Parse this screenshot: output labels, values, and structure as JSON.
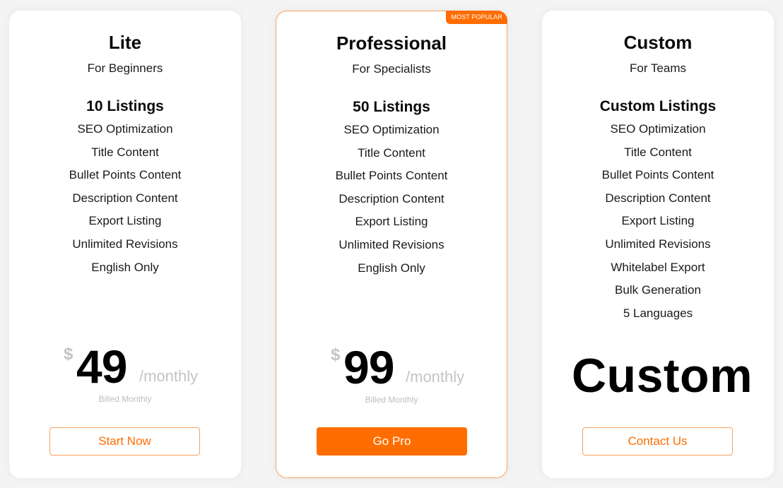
{
  "colors": {
    "accent": "#ff6d00",
    "accent_border": "#f7a25e",
    "muted_text": "#c4c4c4",
    "background": "#f4f4f4",
    "card": "#ffffff"
  },
  "plans": [
    {
      "name": "Lite",
      "audience": "For Beginners",
      "listings": "10 Listings",
      "features": [
        "SEO Optimization",
        "Title Content",
        "Bullet Points Content",
        "Description Content",
        "Export Listing",
        "Unlimited Revisions",
        "English Only"
      ],
      "currency": "$",
      "price": "49",
      "period": "/monthly",
      "billing_note": "Billed Monthly",
      "cta": "Start Now"
    },
    {
      "name": "Professional",
      "badge": "MOST POPULAR",
      "audience": "For Specialists",
      "listings": "50 Listings",
      "features": [
        "SEO Optimization",
        "Title Content",
        "Bullet Points Content",
        "Description Content",
        "Export Listing",
        "Unlimited Revisions",
        "English Only"
      ],
      "currency": "$",
      "price": "99",
      "period": "/monthly",
      "billing_note": "Billed Monthly",
      "cta": "Go Pro"
    },
    {
      "name": "Custom",
      "audience": "For Teams",
      "listings": "Custom Listings",
      "features": [
        "SEO Optimization",
        "Title Content",
        "Bullet Points Content",
        "Description Content",
        "Export Listing",
        "Unlimited Revisions",
        "Whitelabel Export",
        "Bulk Generation",
        "5 Languages"
      ],
      "price_text": "Custom",
      "cta": "Contact Us"
    }
  ]
}
